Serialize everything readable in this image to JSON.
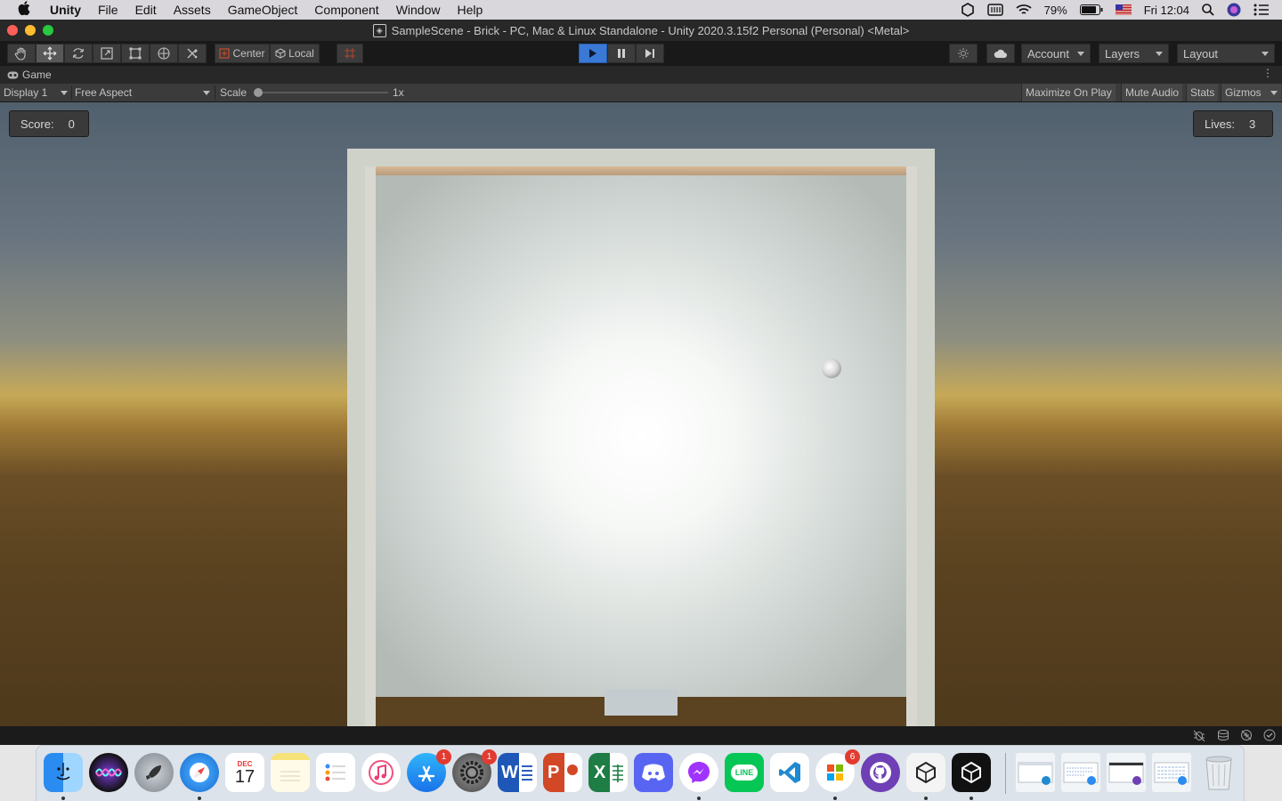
{
  "menubar": {
    "apple_label": "",
    "items": [
      "Unity",
      "File",
      "Edit",
      "Assets",
      "GameObject",
      "Component",
      "Window",
      "Help"
    ],
    "battery": "79%",
    "clock": "Fri 12:04"
  },
  "window": {
    "title": "SampleScene - Brick - PC, Mac & Linux Standalone - Unity 2020.3.15f2 Personal (Personal) <Metal>"
  },
  "toolbar": {
    "pivot_label": "Center",
    "space_label": "Local",
    "account_label": "Account",
    "layers_label": "Layers",
    "layout_label": "Layout"
  },
  "game_view": {
    "tab_label": "Game",
    "display_label": "Display 1",
    "aspect_label": "Free Aspect",
    "scale_label": "Scale",
    "scale_value": "1x",
    "maximize_label": "Maximize On Play",
    "mute_label": "Mute Audio",
    "stats_label": "Stats",
    "gizmos_label": "Gizmos"
  },
  "hud": {
    "score_label": "Score:",
    "score_value": "0",
    "lives_label": "Lives:",
    "lives_value": "3"
  },
  "dock": {
    "calendar_month": "DEC",
    "calendar_day": "17",
    "badges": {
      "app_store": "1",
      "system_prefs": "1",
      "microsoft": "6"
    },
    "app_labels": {
      "word": "W",
      "powerpoint": "P",
      "excel": "X",
      "line": "LINE"
    }
  },
  "colors": {
    "accent_play": "#3a79d6",
    "sky_top": "#51606e",
    "horizon": "#c6a957",
    "ground": "#5a4220"
  }
}
